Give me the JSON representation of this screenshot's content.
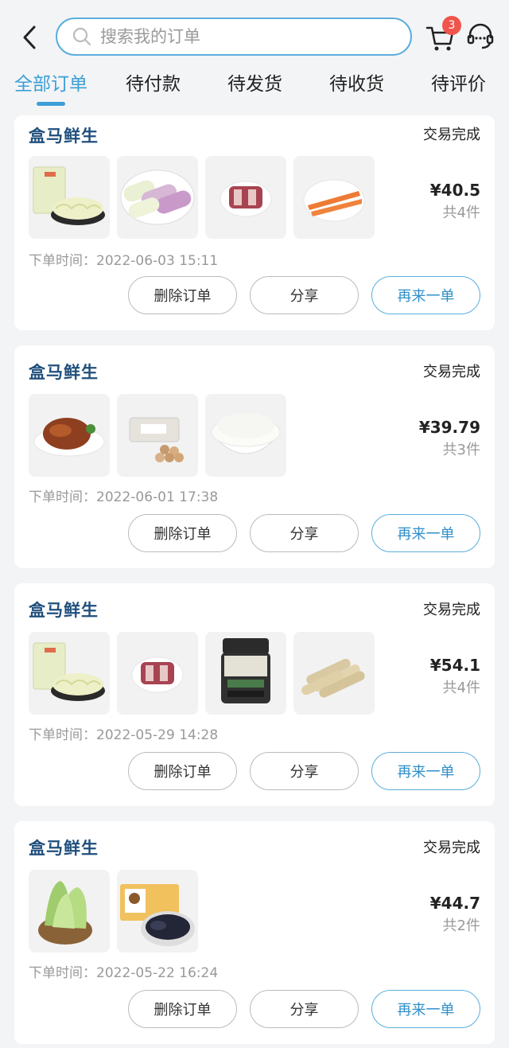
{
  "header": {
    "search_placeholder": "搜索我的订单",
    "cart_badge": "3",
    "icons": {
      "back": "back-arrow-icon",
      "search": "search-icon",
      "cart": "cart-icon",
      "service": "customer-service-icon"
    }
  },
  "tabs": [
    {
      "label": "全部订单",
      "active": true
    },
    {
      "label": "待付款"
    },
    {
      "label": "待发货"
    },
    {
      "label": "待收货"
    },
    {
      "label": "待评价"
    }
  ],
  "colors": {
    "accent": "#3d9fd6",
    "badge": "#f0544b",
    "store": "#1f4f7c"
  },
  "orders": [
    {
      "store": "盒马鲜生",
      "status": "交易完成",
      "items": [
        "shredded-cabbage",
        "corn",
        "pork-ribs",
        "carrots"
      ],
      "price": "¥40.5",
      "count": "共4件",
      "time_label": "下单时间：",
      "time": "2022-06-03 15:11",
      "buttons": {
        "delete": "删除订单",
        "share": "分享",
        "reorder": "再来一单"
      }
    },
    {
      "store": "盒马鲜生",
      "status": "交易完成",
      "items": [
        "roast-chicken",
        "eggs",
        "rice-bowl"
      ],
      "price": "¥39.79",
      "count": "共3件",
      "time_label": "下单时间：",
      "time": "2022-06-01 17:38",
      "buttons": {
        "delete": "删除订单",
        "share": "分享",
        "reorder": "再来一单"
      }
    },
    {
      "store": "盒马鲜生",
      "status": "交易完成",
      "items": [
        "shredded-cabbage",
        "pork-ribs",
        "barley-jar",
        "yam-sticks"
      ],
      "price": "¥54.1",
      "count": "共4件",
      "time_label": "下单时间：",
      "time": "2022-05-29 14:28",
      "buttons": {
        "delete": "删除订单",
        "share": "分享",
        "reorder": "再来一单"
      }
    },
    {
      "store": "盒马鲜生",
      "status": "交易完成",
      "items": [
        "romaine-lettuce",
        "black-chicken"
      ],
      "price": "¥44.7",
      "count": "共2件",
      "time_label": "下单时间：",
      "time": "2022-05-22 16:24",
      "buttons": {
        "delete": "删除订单",
        "share": "分享",
        "reorder": "再来一单"
      }
    }
  ]
}
